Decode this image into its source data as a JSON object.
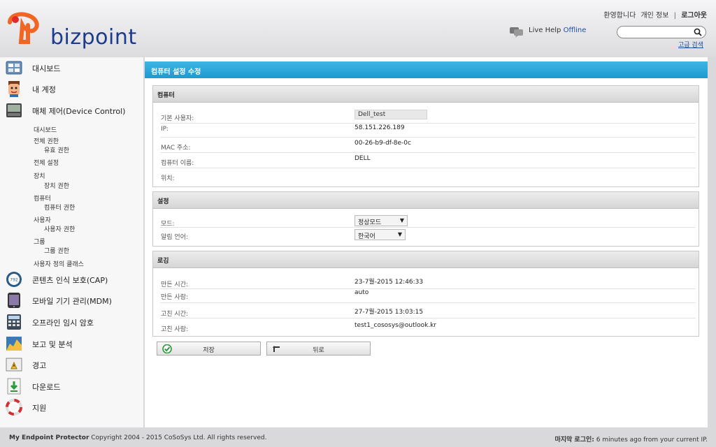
{
  "header": {
    "brand": "bizpoint",
    "welcome": "환영합니다",
    "profile": "개인 정보",
    "logout": "로그아웃",
    "live_help_label": "Live Help",
    "live_help_status": "Offline",
    "search_placeholder": "",
    "advanced_search": "고급 검색"
  },
  "sidebar": {
    "items": [
      {
        "label": "대시보드",
        "icon": "dashboard-icon"
      },
      {
        "label": "내 계정",
        "icon": "user-face-icon"
      },
      {
        "label": "매체 제어(Device Control)",
        "icon": "device-control-icon"
      },
      {
        "label": "콘텐츠 인식 보호(CAP)",
        "icon": "cap-icon"
      },
      {
        "label": "모바일 기기 관리(MDM)",
        "icon": "mobile-icon"
      },
      {
        "label": "오프라인 임시 암호",
        "icon": "calculator-icon"
      },
      {
        "label": "보고 및 분석",
        "icon": "chart-icon"
      },
      {
        "label": "경고",
        "icon": "warning-icon"
      },
      {
        "label": "다운로드",
        "icon": "download-icon"
      },
      {
        "label": "지원",
        "icon": "lifebuoy-icon"
      }
    ],
    "sub_items": [
      "대시보드",
      "전체 권한",
      "유효 권한",
      "전체 설정",
      "장치",
      "장치 권한",
      "컴퓨터",
      "컴퓨터 권한",
      "사용자",
      "사용자 권한",
      "그룹",
      "그룹 권한",
      "사용자 정의 클래스"
    ]
  },
  "main": {
    "title": "컴퓨터 설정 수정",
    "computer_panel": {
      "title": "컴퓨터",
      "default_user_label": "기본 사용자:",
      "default_user_value": "Dell_test",
      "ip_label": "IP:",
      "ip_value": "58.151.226.189",
      "mac_label": "MAC 주소:",
      "mac_value": "00-26-b9-df-8e-0c",
      "name_label": "컴퓨터 이름:",
      "name_value": "DELL",
      "location_label": "위치:",
      "location_value": ""
    },
    "settings_panel": {
      "title": "설정",
      "mode_label": "모드:",
      "mode_value": "정상모드",
      "lang_label": "알림 언어:",
      "lang_value": "한국어"
    },
    "log_panel": {
      "title": "로깅",
      "created_time_label": "만든 시간:",
      "created_time_value": "23-7월-2015 12:46:33",
      "created_by_label": "만든 사람:",
      "created_by_value": "auto",
      "modified_time_label": "고친 시간:",
      "modified_time_value": "27-7월-2015 13:03:15",
      "modified_by_label": "고친 사람:",
      "modified_by_value": "test1_cososys@outlook.kr"
    },
    "save_button": "저장",
    "back_button": "뒤로"
  },
  "footer": {
    "product": "My Endpoint Protector",
    "copyright": "Copyright 2004 - 2015 CoSoSys Ltd. All rights reserved.",
    "last_login_label": "마지막 로그인:",
    "last_login_value": "6 minutes ago from your current IP."
  },
  "colors": {
    "title_bar": "#1e9ad0",
    "brand_blue": "#1d3b8c",
    "logo_orange": "#f26522",
    "link_blue": "#1e4d9c"
  }
}
